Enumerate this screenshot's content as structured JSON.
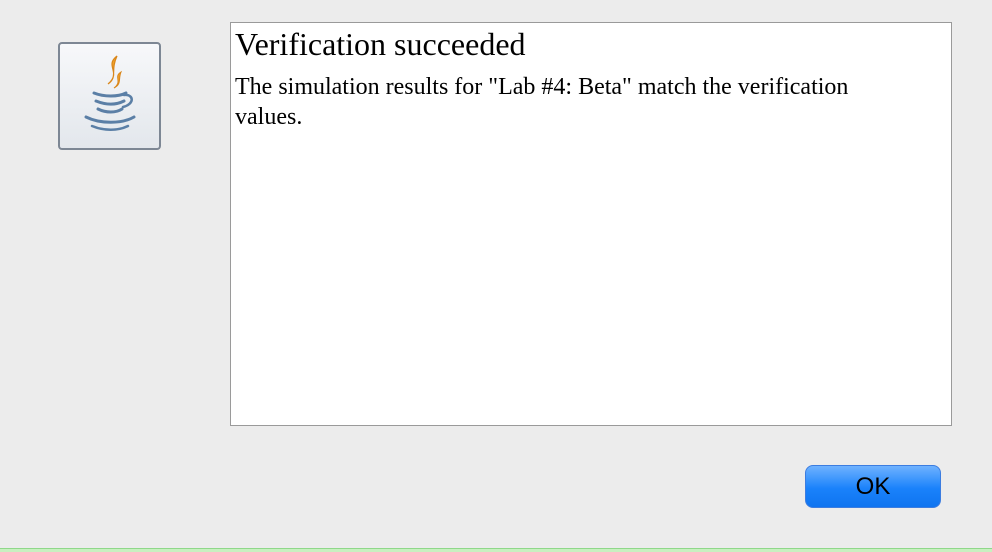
{
  "dialog": {
    "icon": "java-coffee-cup-icon",
    "title": "Verification succeeded",
    "message": "The simulation results for \"Lab #4: Beta\" match the verification values.",
    "ok_label": "OK"
  },
  "colors": {
    "button_accent": "#1a82fb",
    "icon_flame": "#f0a22a",
    "icon_cup": "#5b7fa6"
  }
}
